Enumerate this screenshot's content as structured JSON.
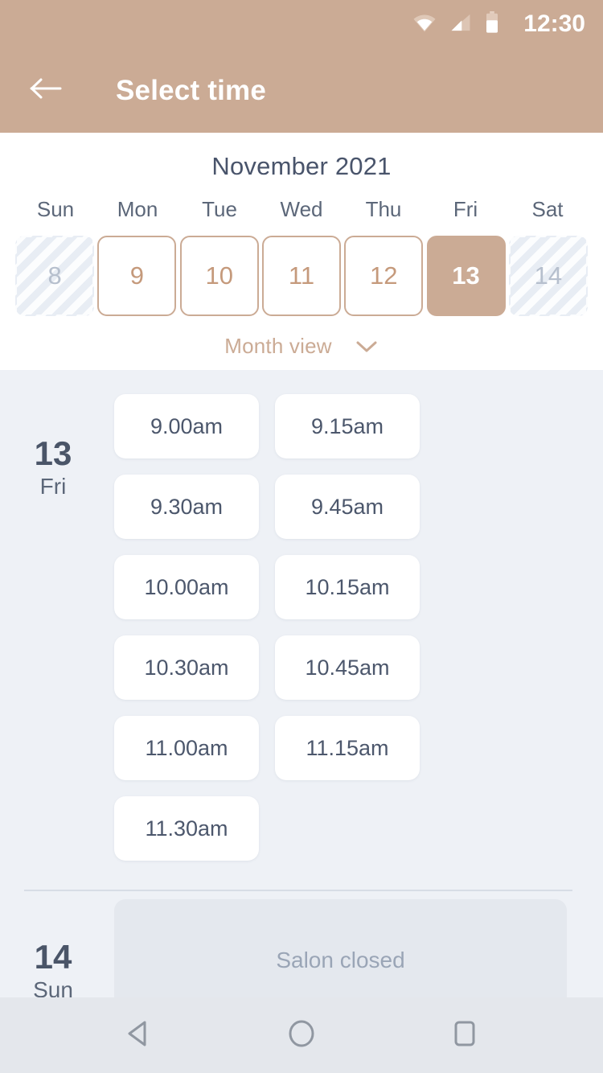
{
  "status_bar": {
    "clock": "12:30",
    "icons": [
      "wifi-icon",
      "signal-icon",
      "battery-icon"
    ]
  },
  "app_bar": {
    "back_icon": "back-arrow-icon",
    "title": "Select time"
  },
  "calendar": {
    "month_title": "November 2021",
    "weekdays": [
      "Sun",
      "Mon",
      "Tue",
      "Wed",
      "Thu",
      "Fri",
      "Sat"
    ],
    "dates": [
      {
        "day": "8",
        "state": "disabled"
      },
      {
        "day": "9",
        "state": "available"
      },
      {
        "day": "10",
        "state": "available"
      },
      {
        "day": "11",
        "state": "available"
      },
      {
        "day": "12",
        "state": "available"
      },
      {
        "day": "13",
        "state": "selected"
      },
      {
        "day": "14",
        "state": "disabled"
      }
    ],
    "view_toggle": {
      "label": "Month view",
      "icon": "chevron-down-icon"
    }
  },
  "schedule": {
    "days": [
      {
        "day_number": "13",
        "day_of_week": "Fri",
        "closed": false,
        "slots": [
          "9.00am",
          "9.15am",
          "9.30am",
          "9.45am",
          "10.00am",
          "10.15am",
          "10.30am",
          "10.45am",
          "11.00am",
          "11.15am",
          "11.30am"
        ]
      },
      {
        "day_number": "14",
        "day_of_week": "Sun",
        "closed": true,
        "closed_label": "Salon closed",
        "slots": []
      }
    ]
  },
  "nav_bar": {
    "buttons": [
      {
        "name": "back-triangle-icon"
      },
      {
        "name": "home-circle-icon"
      },
      {
        "name": "recents-square-icon"
      }
    ]
  },
  "colors": {
    "accent": "#cbab95",
    "accent_text": "#c59a7c",
    "heading": "#49546b",
    "slot_text": "#4c576c",
    "panel_bg": "#eef1f6",
    "closed_bg": "#e4e8ee",
    "closed_text": "#9aa5b6",
    "nav_bg": "#e4e7ec"
  }
}
